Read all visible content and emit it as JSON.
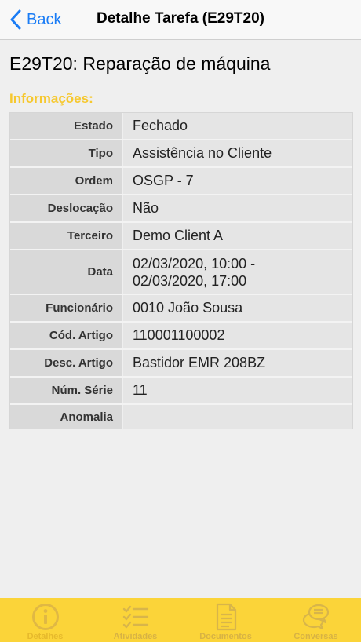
{
  "nav": {
    "back_label": "Back",
    "title": "Detalhe Tarefa (E29T20)"
  },
  "page": {
    "title": "E29T20: Reparação de máquina",
    "section": "Informações:"
  },
  "details": [
    {
      "label": "Estado",
      "value": "Fechado"
    },
    {
      "label": "Tipo",
      "value": "Assistência no Cliente"
    },
    {
      "label": "Ordem",
      "value": "OSGP - 7"
    },
    {
      "label": "Deslocação",
      "value": "Não"
    },
    {
      "label": "Terceiro",
      "value": "Demo Client A"
    },
    {
      "label": "Data",
      "value": "02/03/2020, 10:00 - 02/03/2020, 17:00"
    },
    {
      "label": "Funcionário",
      "value": "0010 João Sousa"
    },
    {
      "label": "Cód. Artigo",
      "value": "110001100002"
    },
    {
      "label": "Desc. Artigo",
      "value": "Bastidor EMR 208BZ"
    },
    {
      "label": "Núm. Série",
      "value": "11"
    },
    {
      "label": "Anomalia",
      "value": ""
    }
  ],
  "tabs": [
    {
      "label": "Detalhes",
      "icon": "info-icon",
      "active": true
    },
    {
      "label": "Atividades",
      "icon": "checklist-icon",
      "active": false
    },
    {
      "label": "Documentos",
      "icon": "document-icon",
      "active": false
    },
    {
      "label": "Conversas",
      "icon": "chat-bubbles-icon",
      "active": false
    }
  ],
  "colors": {
    "accent": "#fbd439",
    "link": "#1a7cf5",
    "section": "#f6c82f"
  }
}
